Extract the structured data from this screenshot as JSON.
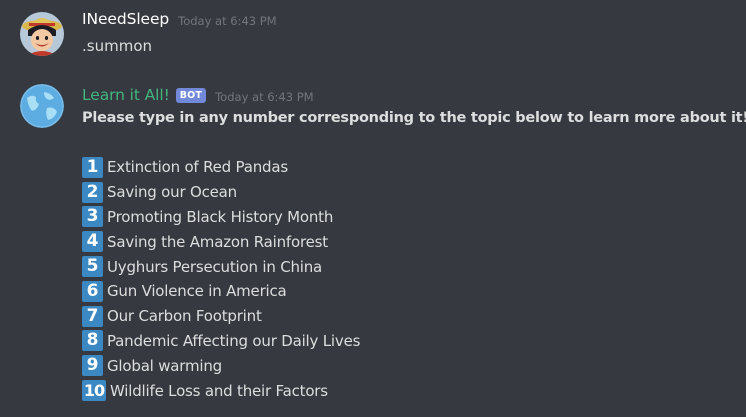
{
  "messages": [
    {
      "username": "INeedSleep",
      "timestamp": "Today at 6:43 PM",
      "text": ".summon"
    },
    {
      "username": "Learn it All!",
      "bot_tag": "BOT",
      "timestamp": "Today at 6:43 PM",
      "text": "Please type in any number corresponding to the topic below to learn more about it!",
      "topics": [
        {
          "num": "1",
          "label": "Extinction of Red Pandas"
        },
        {
          "num": "2",
          "label": "Saving our Ocean"
        },
        {
          "num": "3",
          "label": "Promoting Black History Month"
        },
        {
          "num": "4",
          "label": "Saving the Amazon Rainforest"
        },
        {
          "num": "5",
          "label": "Uyghurs Persecution in China"
        },
        {
          "num": "6",
          "label": "Gun Violence in America"
        },
        {
          "num": "7",
          "label": "Our Carbon Footprint"
        },
        {
          "num": "8",
          "label": "Pandemic Affecting our Daily Lives"
        },
        {
          "num": "9",
          "label": "Global warming"
        },
        {
          "num": "10",
          "label": "Wildlife Loss and their Factors"
        }
      ]
    }
  ],
  "colors": {
    "background": "#36393f",
    "bot_name": "#43b581",
    "bot_tag": "#7289da",
    "number_badge": "#3b88c3"
  },
  "icons": {
    "user_avatar": "anime-character-straw-hat-avatar",
    "bot_avatar": "earth-globe-avatar"
  }
}
